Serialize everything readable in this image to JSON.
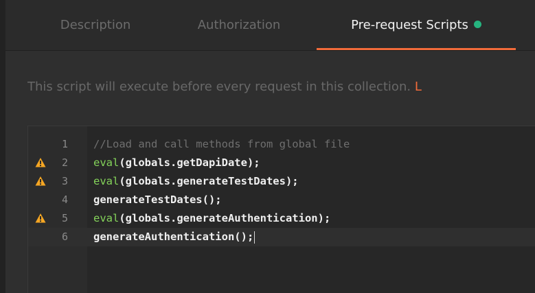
{
  "tabs": [
    {
      "label": "Description"
    },
    {
      "label": "Authorization"
    },
    {
      "label": "Pre-request Scripts",
      "active": true
    }
  ],
  "description": {
    "text": "This script will execute before every request in this collection.",
    "link_fragment": "L"
  },
  "editor": {
    "lines": [
      {
        "number": "1",
        "warning": false,
        "keyword": "",
        "text": "//Load and call methods from global file",
        "comment": true
      },
      {
        "number": "2",
        "warning": true,
        "keyword": "eval",
        "text": "(globals.getDapiDate);"
      },
      {
        "number": "3",
        "warning": true,
        "keyword": "eval",
        "text": "(globals.generateTestDates);"
      },
      {
        "number": "4",
        "warning": false,
        "keyword": "",
        "text": "generateTestDates();"
      },
      {
        "number": "5",
        "warning": true,
        "keyword": "eval",
        "text": "(globals.generateAuthentication);"
      },
      {
        "number": "6",
        "warning": false,
        "keyword": "",
        "text": "generateAuthentication();",
        "active": true
      }
    ]
  },
  "colors": {
    "accent": "#f26b3a",
    "dirty_dot": "#26b47f",
    "warning": "#f5a623",
    "keyword": "#84d35a"
  },
  "icons": {
    "warning": "warning-triangle-icon",
    "status": "unsaved-changes-dot-icon"
  }
}
